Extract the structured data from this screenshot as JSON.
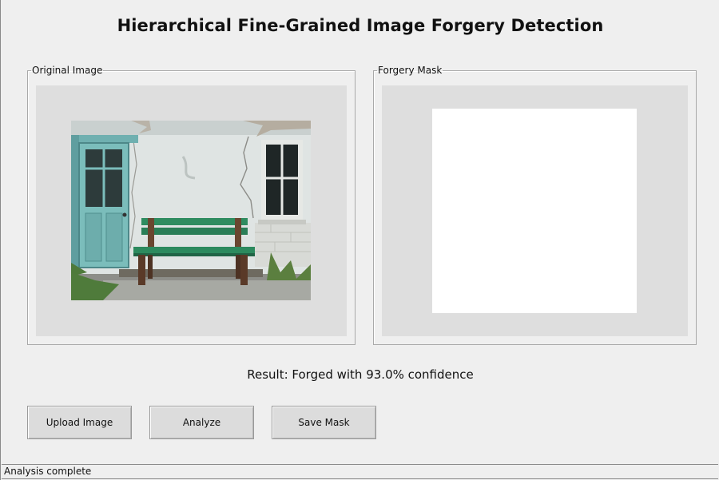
{
  "window": {
    "title": "Hierarchical Fine-Grained Image Forgery Detection"
  },
  "panels": {
    "original": {
      "label": "Original Image"
    },
    "mask": {
      "label": "Forgery Mask"
    }
  },
  "result": {
    "text": "Result: Forged with 93.0% confidence"
  },
  "buttons": {
    "upload": "Upload Image",
    "analyze": "Analyze",
    "save_mask": "Save Mask"
  },
  "status": {
    "text": "Analysis complete"
  },
  "colors": {
    "background": "#efefef",
    "canvas": "#dedede",
    "mask": "#ffffff"
  }
}
